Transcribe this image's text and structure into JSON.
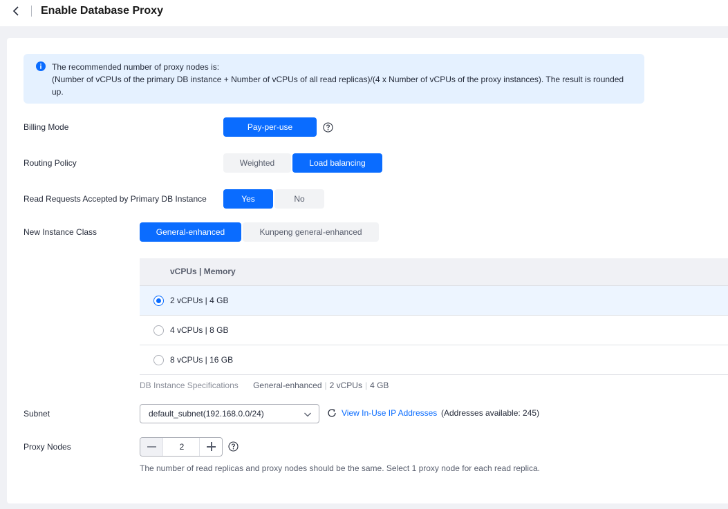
{
  "header": {
    "title": "Enable Database Proxy"
  },
  "alert": {
    "line1": "The recommended number of proxy nodes is:",
    "line2": "(Number of vCPUs of the primary DB instance + Number of vCPUs of all read replicas)/(4 x Number of vCPUs of the proxy instances). The result is rounded up."
  },
  "billing": {
    "label": "Billing Mode",
    "option": "Pay-per-use"
  },
  "routing": {
    "label": "Routing Policy",
    "options": [
      "Weighted",
      "Load balancing"
    ],
    "selected": "Load balancing"
  },
  "read_requests": {
    "label": "Read Requests Accepted by Primary DB Instance",
    "options": [
      "Yes",
      "No"
    ],
    "selected": "Yes"
  },
  "instance_class": {
    "label": "New Instance Class",
    "options": [
      "General-enhanced",
      "Kunpeng general-enhanced"
    ],
    "selected": "General-enhanced"
  },
  "spec_table": {
    "header": "vCPUs | Memory",
    "rows": [
      "2 vCPUs | 4 GB",
      "4 vCPUs | 8 GB",
      "8 vCPUs | 16 GB"
    ],
    "selected_index": 0
  },
  "spec_summary": {
    "label": "DB Instance Specifications",
    "class": "General-enhanced",
    "vcpus": "2 vCPUs",
    "memory": "4 GB"
  },
  "subnet": {
    "label": "Subnet",
    "value": "default_subnet(192.168.0.0/24)",
    "link": "View In-Use IP Addresses",
    "available": "(Addresses available: 245)"
  },
  "proxy_nodes": {
    "label": "Proxy Nodes",
    "value": "2",
    "note": "The number of read replicas and proxy nodes should be the same. Select 1 proxy node for each read replica."
  },
  "colors": {
    "primary": "#0a6cff",
    "alert_bg": "#e5f1ff",
    "page_bg": "#f0f1f5"
  }
}
